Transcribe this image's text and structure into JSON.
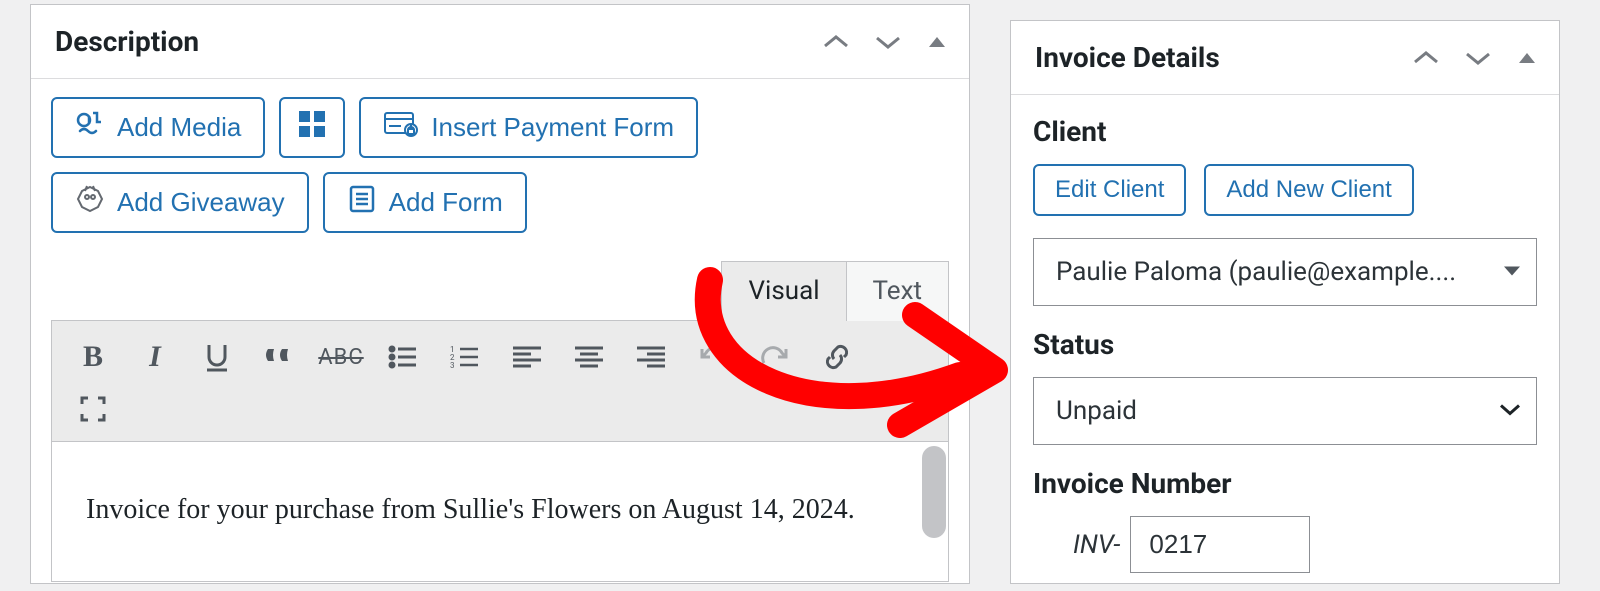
{
  "main": {
    "title": "Description",
    "buttons": {
      "add_media": "Add Media",
      "insert_payment_form": "Insert Payment Form",
      "add_giveaway": "Add Giveaway",
      "add_form": "Add Form"
    },
    "tabs": {
      "visual": "Visual",
      "text": "Text"
    },
    "toolbar": {
      "bold": "B",
      "italic": "I",
      "strike": "ABC"
    },
    "content": "Invoice for your purchase from Sullie's Flowers on August 14, 2024."
  },
  "sidebar": {
    "title": "Invoice Details",
    "client": {
      "label": "Client",
      "edit": "Edit Client",
      "add": "Add New Client",
      "selected": "Paulie Paloma (paulie@example...."
    },
    "status": {
      "label": "Status",
      "selected": "Unpaid"
    },
    "invoice_number": {
      "label": "Invoice Number",
      "prefix": "INV-",
      "value": "0217"
    }
  },
  "colors": {
    "accent": "#2271b1",
    "annotation": "#ff0000"
  }
}
